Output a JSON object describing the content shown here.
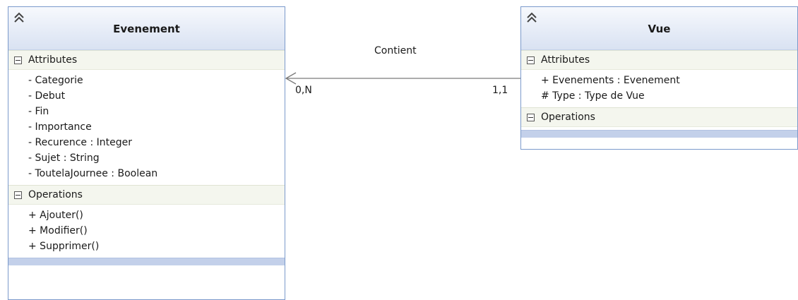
{
  "association": {
    "name": "Contient",
    "source_multiplicity": "0,N",
    "target_multiplicity": "1,1"
  },
  "classes": {
    "evenement": {
      "name": "Evenement",
      "attributes_title": "Attributes",
      "attributes": [
        "- Categorie",
        "- Debut",
        "- Fin",
        "- Importance",
        "- Recurence : Integer",
        "- Sujet : String",
        "- ToutelaJournee : Boolean"
      ],
      "operations_title": "Operations",
      "operations": [
        "+ Ajouter()",
        "+ Modifier()",
        "+ Supprimer()"
      ]
    },
    "vue": {
      "name": "Vue",
      "attributes_title": "Attributes",
      "attributes": [
        "+ Evenements : Evenement",
        "# Type : Type de Vue"
      ],
      "operations_title": "Operations",
      "operations": []
    }
  },
  "colors": {
    "border": "#7b9acb",
    "header_gradient_end": "#d9e2f2",
    "section_bg": "#f4f6ee",
    "footer": "#c3d0ea",
    "line": "#7a7a7a"
  }
}
